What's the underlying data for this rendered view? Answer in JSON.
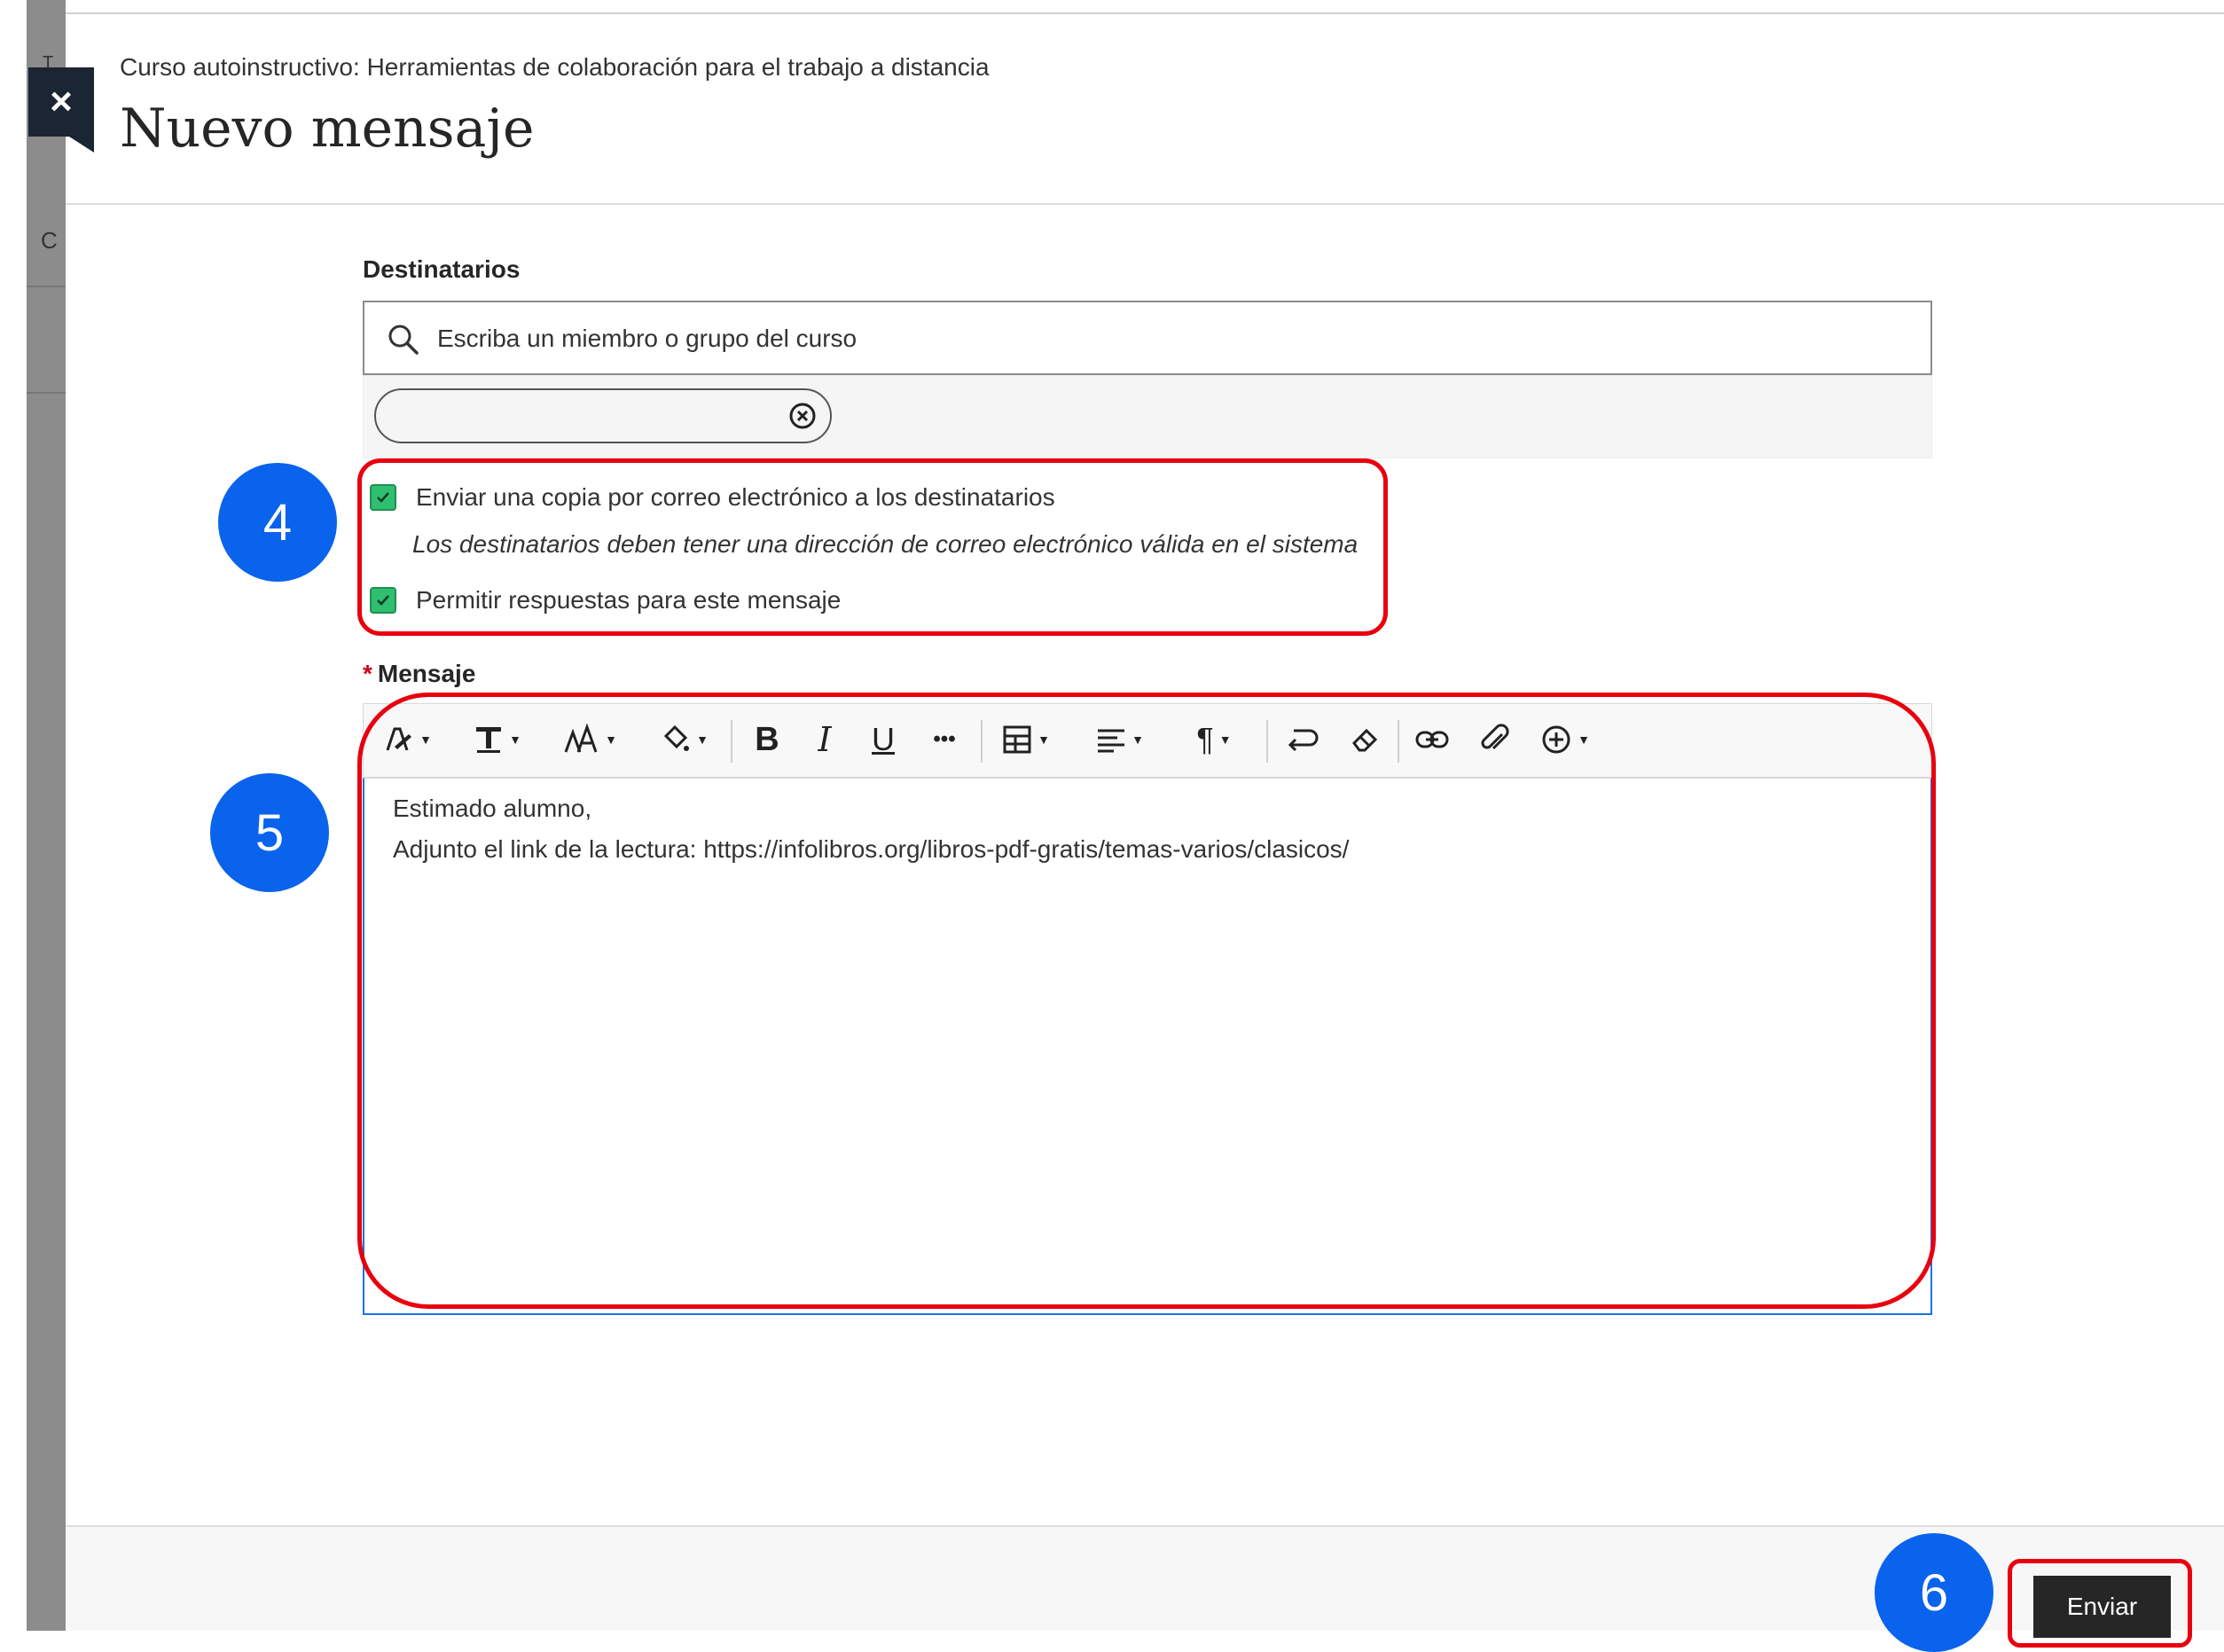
{
  "header": {
    "breadcrumb": "Curso autoinstructivo: Herramientas de colaboración para el trabajo a distancia",
    "title": "Nuevo mensaje",
    "close_label": "×"
  },
  "background_peek": {
    "top_text": "T",
    "mid_text": "C"
  },
  "recipients": {
    "label": "Destinatarios",
    "placeholder": "Escriba un miembro o grupo del curso"
  },
  "options": {
    "email_copy": {
      "label": "Enviar una copia por correo electrónico a los destinatarios",
      "checked": true
    },
    "email_hint": "Los destinatarios deben tener una dirección de correo electrónico válida en el sistema",
    "allow_replies": {
      "label": "Permitir respuestas para este mensaje",
      "checked": true
    }
  },
  "message": {
    "required_mark": "*",
    "label": "Mensaje",
    "lines": [
      "Estimado alumno,",
      "Adjunto el link de la lectura: https://infolibros.org/libros-pdf-gratis/temas-varios/clasicos/"
    ]
  },
  "toolbar": {
    "bold": "B",
    "italic": "I",
    "underline": "U",
    "more": "•••",
    "paragraph": "¶"
  },
  "annotations": {
    "badge_4": "4",
    "badge_5": "5",
    "badge_6": "6"
  },
  "footer": {
    "send_label": "Enviar"
  },
  "colors": {
    "annotation_red": "#e8000f",
    "badge_blue": "#0a63ec",
    "check_green": "#2fbf71",
    "send_bg": "#262626"
  }
}
